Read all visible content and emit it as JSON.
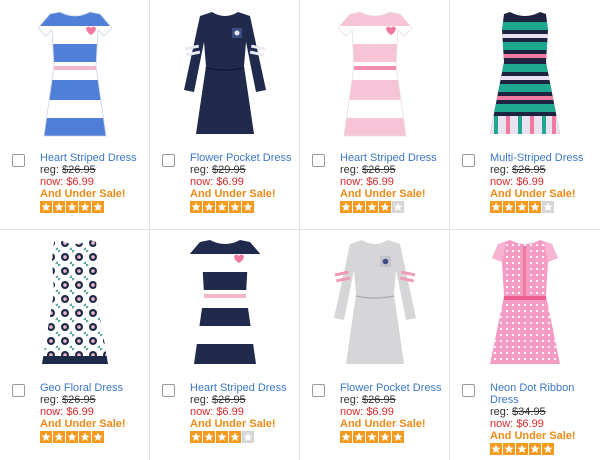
{
  "colors": {
    "link": "#3a78c6",
    "now_price": "#d92b2b",
    "sale": "#ee8a17",
    "star_on": "#f39a1f",
    "star_off": "#d6d6d6"
  },
  "products": [
    {
      "name": "Heart Striped Dress",
      "reg_label": "reg:",
      "reg_price": "$26.95",
      "now_label": "now:",
      "now_price": "$6.99",
      "sale": "And Under Sale!",
      "rating": 5,
      "icon": "striped-dress-blue-white"
    },
    {
      "name": "Flower Pocket Dress",
      "reg_label": "reg:",
      "reg_price": "$29.95",
      "now_label": "now:",
      "now_price": "$6.99",
      "sale": "And Under Sale!",
      "rating": 5,
      "icon": "navy-long-sleeve-dress"
    },
    {
      "name": "Heart Striped Dress",
      "reg_label": "reg:",
      "reg_price": "$26.95",
      "now_label": "now:",
      "now_price": "$6.99",
      "sale": "And Under Sale!",
      "rating": 4,
      "icon": "striped-dress-pink-white"
    },
    {
      "name": "Multi-Striped Dress",
      "reg_label": "reg:",
      "reg_price": "$26.95",
      "now_label": "now:",
      "now_price": "$6.99",
      "sale": "And Under Sale!",
      "rating": 4,
      "icon": "multi-striped-dress"
    },
    {
      "name": "Geo Floral Dress",
      "reg_label": "reg:",
      "reg_price": "$26.95",
      "now_label": "now:",
      "now_price": "$6.99",
      "sale": "And Under Sale!",
      "rating": 5,
      "icon": "geo-floral-dress"
    },
    {
      "name": "Heart Striped Dress",
      "reg_label": "reg:",
      "reg_price": "$26.95",
      "now_label": "now:",
      "now_price": "$6.99",
      "sale": "And Under Sale!",
      "rating": 4,
      "icon": "striped-dress-navy-white"
    },
    {
      "name": "Flower Pocket Dress",
      "reg_label": "reg:",
      "reg_price": "$26.95",
      "now_label": "now:",
      "now_price": "$6.99",
      "sale": "And Under Sale!",
      "rating": 5,
      "icon": "grey-long-sleeve-dress"
    },
    {
      "name": "Neon Dot Ribbon Dress",
      "reg_label": "reg:",
      "reg_price": "$34.95",
      "now_label": "now:",
      "now_price": "$6.99",
      "sale": "And Under Sale!",
      "rating": 5,
      "icon": "pink-dot-dress"
    }
  ]
}
